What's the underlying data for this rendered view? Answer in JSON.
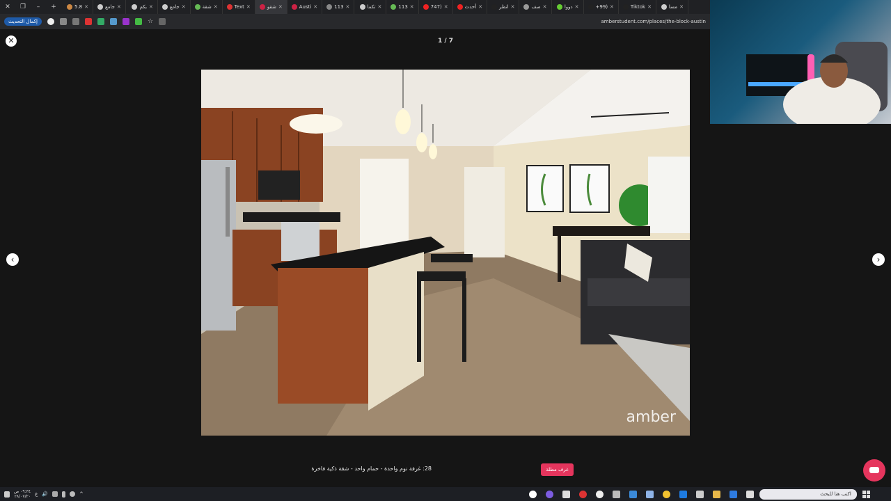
{
  "browser": {
    "tabs": [
      {
        "label": "5.8",
        "color": "#c84"
      },
      {
        "label": "جامع",
        "color": "#ccc"
      },
      {
        "label": "بكم",
        "color": "#ccc"
      },
      {
        "label": "جامع",
        "color": "#ccc"
      },
      {
        "label": "شقة",
        "color": "#6b5"
      },
      {
        "label": "Text",
        "color": "#d33"
      },
      {
        "label": "شقو",
        "color": "#c24",
        "active": true
      },
      {
        "label": "Austi",
        "color": "#c24"
      },
      {
        "label": "113",
        "color": "#888"
      },
      {
        "label": "تكما",
        "color": "#ccc"
      },
      {
        "label": "113",
        "color": "#6b5"
      },
      {
        "label": "(747",
        "color": "#e22"
      },
      {
        "label": "أحدث",
        "color": "#e22"
      },
      {
        "label": "انظر",
        "color": "#222"
      },
      {
        "label": "صف",
        "color": "#999"
      },
      {
        "label": "دووا",
        "color": "#6c3"
      },
      {
        "label": "(99+",
        "color": "#222"
      },
      {
        "label": "Tiktok",
        "color": "#222"
      },
      {
        "label": "مسا",
        "color": "#ccc"
      }
    ],
    "update_button": "إكمال التحديث",
    "url": "amberstudent.com/places/the-block-austin"
  },
  "gallery": {
    "counter": "1 / 7",
    "watermark": "amber",
    "caption": "28: غرفة نوم واحدة - حمام واحد - شقة ذكية فاخرة",
    "cta": "غرف مطلة"
  },
  "taskbar": {
    "time": "٠٩:٣٤ ص",
    "date": "٢٨/٠٧/٢٠",
    "search_placeholder": "اكتب هنا للبحث"
  }
}
